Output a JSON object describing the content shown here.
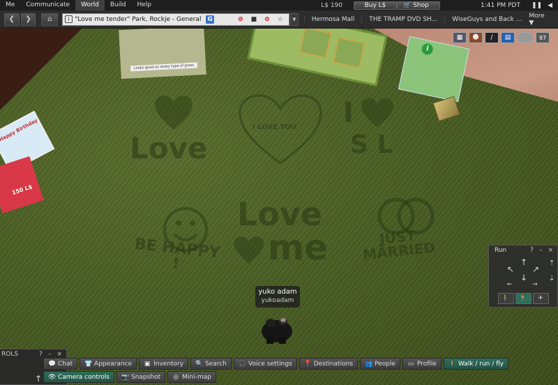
{
  "menubar": {
    "items": [
      {
        "label": "Me"
      },
      {
        "label": "Communicate"
      },
      {
        "label": "World",
        "active": true
      },
      {
        "label": "Build"
      },
      {
        "label": "Help"
      }
    ],
    "balance": "L$ 190",
    "buy_label": "Buy L$",
    "shop_label": "Shop",
    "clock": "1:41 PM PDT",
    "pause_glyph": "❚❚",
    "sound_glyph": "◀"
  },
  "navbar": {
    "location": "\"Love me tender\" Park, Rockje - General",
    "rating_badge": "G",
    "favorites": [
      "Hermosa Mall",
      "THE TRAMP DVD SH...",
      "WiseGuys and Back ..."
    ],
    "more_label": "More ▼"
  },
  "hud": {
    "count": "97"
  },
  "world": {
    "mown_texts": [
      "Love",
      "I LOVE YOU",
      "I",
      "S L",
      "Love",
      "me",
      "BE HAPPY !",
      "JUST MARRIED"
    ],
    "poster_caption": "Looks good on every type of grass",
    "birthday_card": "Happy Birthday",
    "price_sign": "150 L$",
    "avatar_name": "yuko adam",
    "avatar_username": "yukoadam"
  },
  "move_panel": {
    "title": "Run",
    "help": "?",
    "minimize": "–",
    "close": "×"
  },
  "side_floater": {
    "title": "ROLS",
    "help": "?",
    "minimize": "–",
    "close": "×"
  },
  "toolbar": {
    "row1": [
      {
        "label": "Chat",
        "icon": "chat-icon"
      },
      {
        "label": "Appearance",
        "icon": "shirt-icon"
      },
      {
        "label": "Inventory",
        "icon": "inventory-icon"
      },
      {
        "label": "Search",
        "icon": "search-icon"
      },
      {
        "label": "Voice settings",
        "icon": "headset-icon"
      },
      {
        "label": "Destinations",
        "icon": "pin-icon"
      },
      {
        "label": "People",
        "icon": "people-icon"
      },
      {
        "label": "Profile",
        "icon": "profile-icon"
      },
      {
        "label": "Walk / run / fly",
        "icon": "walk-icon",
        "active": true
      }
    ],
    "row2": [
      {
        "label": "Camera controls",
        "icon": "eye-icon",
        "active": true
      },
      {
        "label": "Snapshot",
        "icon": "camera-icon"
      },
      {
        "label": "Mini-map",
        "icon": "radar-icon"
      }
    ]
  },
  "colors": {
    "accent_active": "#2f6e5c",
    "grass": "#4a5e22",
    "menubar_bg": "#1e1e1e"
  }
}
